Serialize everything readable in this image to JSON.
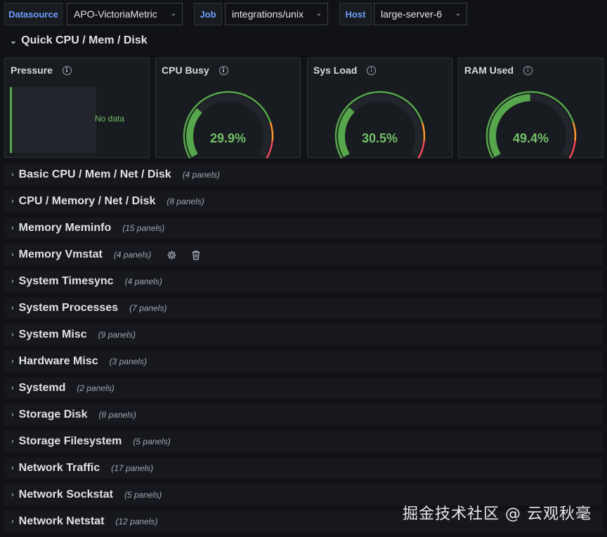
{
  "variables": [
    {
      "label": "Datasource",
      "value": "APO-VictoriaMetric"
    },
    {
      "label": "Job",
      "value": "integrations/unix"
    },
    {
      "label": "Host",
      "value": "large-server-6"
    }
  ],
  "section": {
    "title": "Quick CPU / Mem / Disk"
  },
  "panels": {
    "pressure": {
      "title": "Pressure",
      "no_data": "No data"
    },
    "cpu_busy": {
      "title": "CPU Busy",
      "value": "29.9%",
      "percent": 29.9
    },
    "sys_load": {
      "title": "Sys Load",
      "value": "30.5%",
      "percent": 30.5
    },
    "ram_used": {
      "title": "RAM Used",
      "value": "49.4%",
      "percent": 49.4
    }
  },
  "colors": {
    "ok": "#56a64b",
    "warn": "#ff9830",
    "crit": "#f2495c",
    "track": "#22252b",
    "link": "#6e9fff"
  },
  "rows": [
    {
      "title": "Basic CPU / Mem / Net / Disk",
      "count": "(4 panels)"
    },
    {
      "title": "CPU / Memory / Net / Disk",
      "count": "(8 panels)"
    },
    {
      "title": "Memory Meminfo",
      "count": "(15 panels)"
    },
    {
      "title": "Memory Vmstat",
      "count": "(4 panels)",
      "icons": [
        "gear-icon",
        "trash-icon"
      ]
    },
    {
      "title": "System Timesync",
      "count": "(4 panels)"
    },
    {
      "title": "System Processes",
      "count": "(7 panels)"
    },
    {
      "title": "System Misc",
      "count": "(9 panels)"
    },
    {
      "title": "Hardware Misc",
      "count": "(3 panels)"
    },
    {
      "title": "Systemd",
      "count": "(2 panels)"
    },
    {
      "title": "Storage Disk",
      "count": "(8 panels)"
    },
    {
      "title": "Storage Filesystem",
      "count": "(5 panels)"
    },
    {
      "title": "Network Traffic",
      "count": "(17 panels)"
    },
    {
      "title": "Network Sockstat",
      "count": "(5 panels)"
    },
    {
      "title": "Network Netstat",
      "count": "(12 panels)"
    }
  ],
  "watermark": "掘金技术社区 @ 云观秋毫"
}
